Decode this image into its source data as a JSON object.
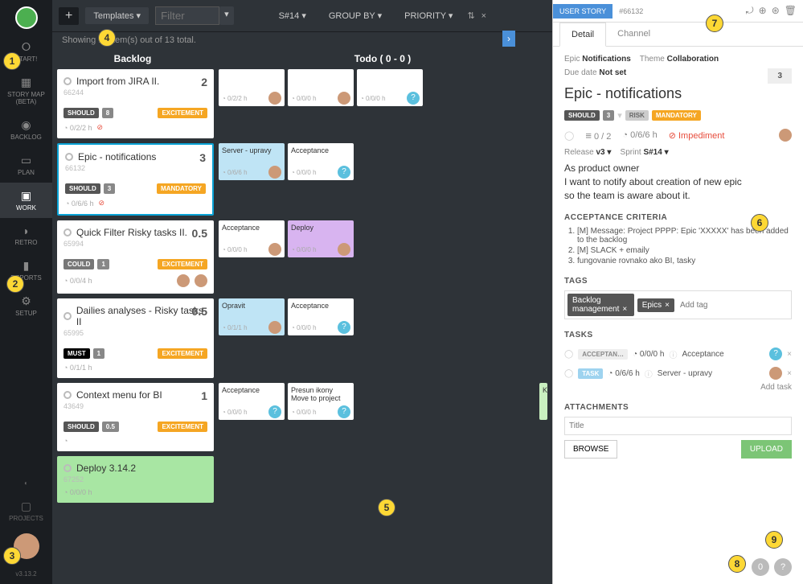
{
  "nav": {
    "items": [
      {
        "label": "START!",
        "icon": "●"
      },
      {
        "label": "STORY MAP (BETA)",
        "icon": "▦"
      },
      {
        "label": "BACKLOG",
        "icon": "⚑"
      },
      {
        "label": "PLAN",
        "icon": "◧"
      },
      {
        "label": "WORK",
        "icon": "▣",
        "active": true
      },
      {
        "label": "RETRO",
        "icon": "💬"
      },
      {
        "label": "REPORTS",
        "icon": "📊"
      },
      {
        "label": "SETUP",
        "icon": "⚙"
      }
    ],
    "projects_label": "PROJECTS",
    "version": "v3.13.2"
  },
  "toolbar": {
    "templates": "Templates ▾",
    "filter_placeholder": "Filter",
    "sprint": "S#14 ▾",
    "groupby": "GROUP BY ▾",
    "priority": "PRIORITY ▾"
  },
  "count_line": "Showing 13 item(s) out of 13 total.",
  "columns": {
    "backlog": "Backlog",
    "todo": "Todo (   0   -   0   )"
  },
  "rows": [
    {
      "card": {
        "title": "Import from JIRA II.",
        "id": "66244",
        "points": "2",
        "priority": "SHOULD",
        "pnum": "8",
        "label": "EXCITEMENT",
        "meta": "0/2/2 h",
        "clock": true,
        "truncated": true
      },
      "tasks": [
        {
          "title": "",
          "meta": "0/2/2 h",
          "avatar": "user"
        },
        {
          "title": "",
          "meta": "0/0/0 h",
          "avatar": "user"
        },
        {
          "title": "",
          "meta": "0/0/0 h",
          "avatar": "blue"
        }
      ]
    },
    {
      "card": {
        "title": "Epic - notifications",
        "id": "66132",
        "points": "3",
        "priority": "SHOULD",
        "pnum": "3",
        "label": "MANDATORY",
        "meta": "0/6/6 h",
        "clock": true,
        "selected": true
      },
      "tasks": [
        {
          "title": "Server - upravy",
          "meta": "0/6/6 h",
          "avatar": "user",
          "color": "blue"
        },
        {
          "title": "Acceptance",
          "meta": "0/0/0 h",
          "avatar": "blue"
        }
      ]
    },
    {
      "card": {
        "title": "Quick Filter Risky tasks II.",
        "id": "65994",
        "points": "0.5",
        "priority": "COULD",
        "pnum": "1",
        "label": "EXCITEMENT",
        "meta": "0/0/4 h",
        "avatars": 2
      },
      "tasks": [
        {
          "title": "Acceptance",
          "meta": "0/0/0 h",
          "avatar": "user"
        },
        {
          "title": "Deploy",
          "meta": "0/0/0 h",
          "avatar": "user",
          "color": "purple"
        }
      ]
    },
    {
      "card": {
        "title": "Dailies analyses - Risky tasks II",
        "id": "65995",
        "points": "0.5",
        "priority": "MUST",
        "pnum": "1",
        "label": "EXCITEMENT",
        "meta": "0/1/1 h"
      },
      "tasks": [
        {
          "title": "Opravit",
          "meta": "0/1/1 h",
          "avatar": "user",
          "color": "blue"
        },
        {
          "title": "Acceptance",
          "meta": "0/0/0 h",
          "avatar": "blue"
        }
      ]
    },
    {
      "card": {
        "title": "Context menu for BI",
        "id": "43649",
        "points": "1",
        "priority": "SHOULD",
        "pnum": "0.5",
        "label": "EXCITEMENT",
        "meta": ""
      },
      "tasks": [
        {
          "title": "Acceptance",
          "meta": "0/0/0 h",
          "avatar": "blue"
        },
        {
          "title": "Presun ikony Move to project",
          "meta": "0/0/0 h",
          "avatar": "blue"
        }
      ],
      "peek": "Klien"
    },
    {
      "card": {
        "title": "Deploy 3.14.2",
        "id": "67252",
        "points": "",
        "priority": "",
        "pnum": "",
        "label": "",
        "meta": "0/0/0 h",
        "green": true
      },
      "tasks": []
    }
  ],
  "detail": {
    "type_chip": "USER STORY",
    "id_chip": "#66132",
    "tabs": {
      "detail": "Detail",
      "channel": "Channel"
    },
    "epic_label": "Epic",
    "epic_value": "Notifications",
    "theme_label": "Theme",
    "theme_value": "Collaboration",
    "due_label": "Due date",
    "due_value": "Not set",
    "points": "3",
    "title": "Epic - notifications",
    "badges": {
      "should": "SHOULD",
      "num": "3",
      "risk": "RISK",
      "mand": "MANDATORY"
    },
    "stats": {
      "tasks": "0 / 2",
      "time": "0/6/6 h",
      "imped": "Impediment"
    },
    "release_label": "Release",
    "release_value": "v3 ▾",
    "sprint_label": "Sprint",
    "sprint_value": "S#14 ▾",
    "story": [
      "As product owner",
      "I want to notify about creation of new epic",
      "so the team is aware about it."
    ],
    "ac_label": "ACCEPTANCE CRITERIA",
    "ac": [
      "[M] Message: Project PPPP: Epic 'XXXXX' has been added to the backlog",
      "[M] SLACK + emaily",
      "fungovanie rovnako ako BI, tasky"
    ],
    "tags_label": "TAGS",
    "tags": [
      "Backlog management",
      "Epics"
    ],
    "add_tag_placeholder": "Add tag",
    "tasks_label": "TASKS",
    "task_rows": [
      {
        "chip": "ACCEPTAN…",
        "time": "0/0/0 h",
        "name": "Acceptance",
        "avatar": "blue"
      },
      {
        "chip": "TASK",
        "chip_blue": true,
        "time": "0/6/6 h",
        "name": "Server - upravy",
        "avatar": "user"
      }
    ],
    "add_task": "Add task",
    "attach_label": "ATTACHMENTS",
    "attach_placeholder": "Title",
    "browse": "BROWSE",
    "upload": "UPLOAD"
  },
  "footer": {
    "count": "0",
    "help": "?"
  },
  "annotations": [
    "1",
    "2",
    "3",
    "4",
    "5",
    "6",
    "7",
    "8",
    "9"
  ]
}
